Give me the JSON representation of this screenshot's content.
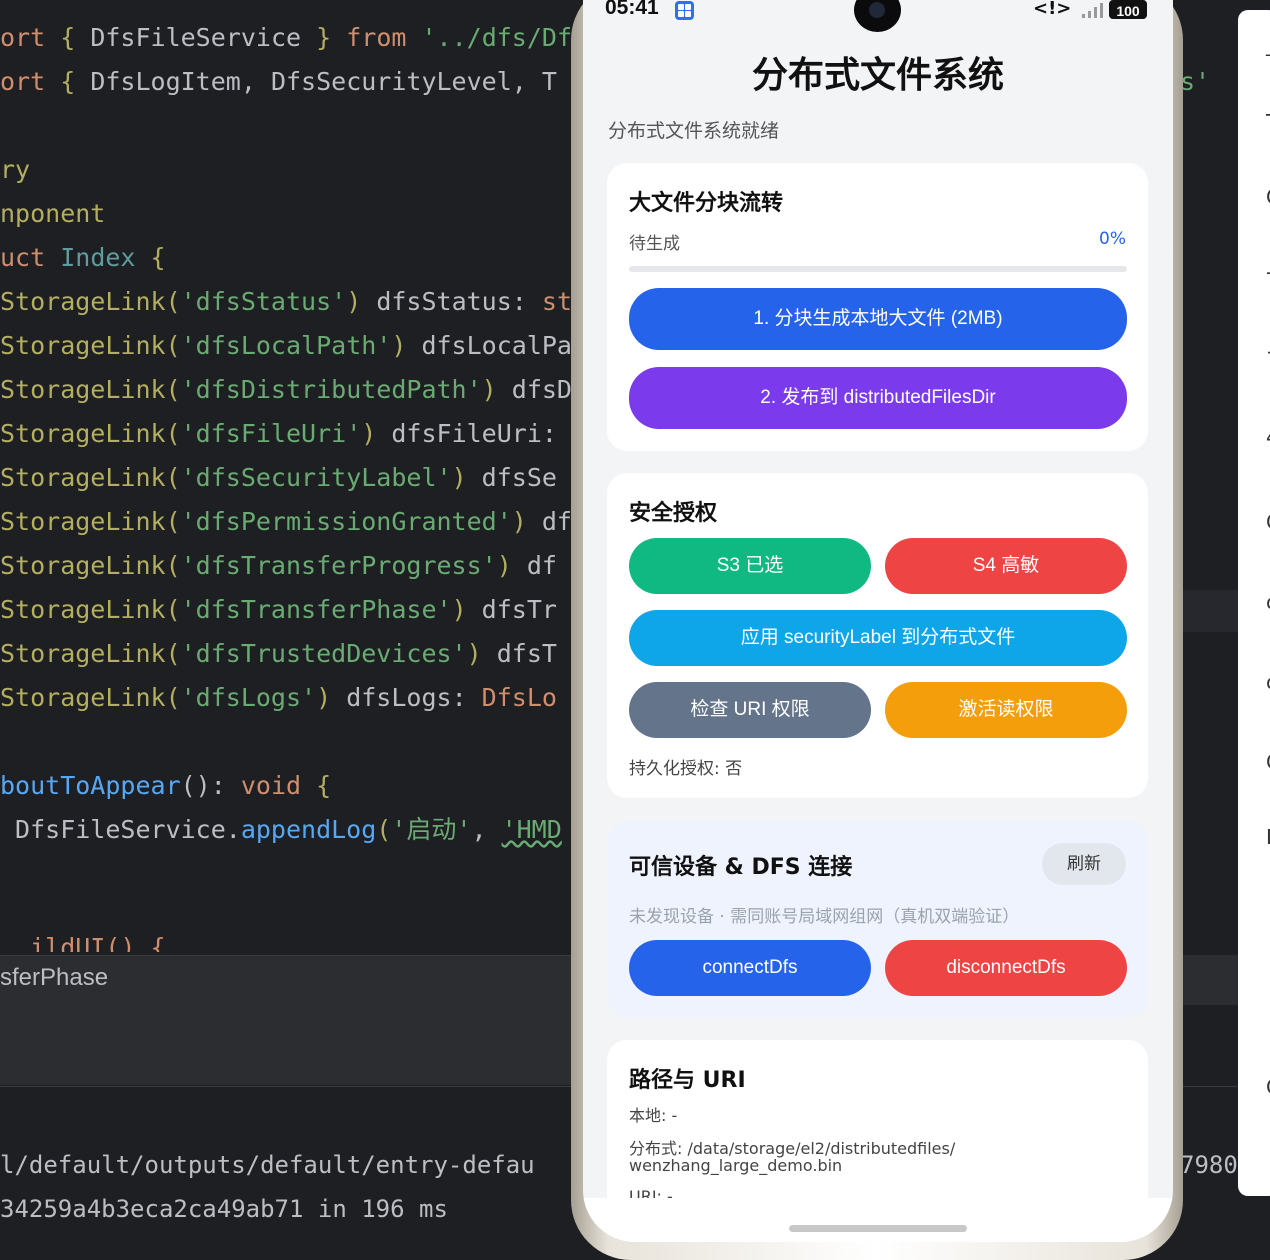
{
  "editor": {
    "lines": [
      {
        "p1": "ort ",
        "p2": "{ ",
        "p3": "DfsFileService ",
        "p4": "} ",
        "p5": "from ",
        "p6": "'../dfs/Df"
      },
      {
        "p1": "ort ",
        "p2": "{ ",
        "p3": "DfsLogItem, DfsSecurityLevel, T",
        "p4": "",
        "p5": "",
        "p6": ""
      },
      {
        "p1": "ry"
      },
      {
        "p1": "nponent"
      },
      {
        "p1": "uct ",
        "p2": "Index ",
        "p3": "{"
      }
    ],
    "storage_links": [
      {
        "key": "'dfsStatus'",
        "var": " dfsStatus: ",
        "tail": "st"
      },
      {
        "key": "'dfsLocalPath'",
        "var": " dfsLocalPa",
        "tail": ""
      },
      {
        "key": "'dfsDistributedPath'",
        "var": " dfsD",
        "tail": ""
      },
      {
        "key": "'dfsFileUri'",
        "var": " dfsFileUri:",
        "tail": ""
      },
      {
        "key": "'dfsSecurityLabel'",
        "var": " dfsSe",
        "tail": ""
      },
      {
        "key": "'dfsPermissionGranted'",
        "var": " df",
        "tail": ""
      },
      {
        "key": "'dfsTransferProgress'",
        "var": " df",
        "tail": ""
      },
      {
        "key": "'dfsTransferPhase'",
        "var": " dfsTr",
        "tail": ""
      },
      {
        "key": "'dfsTrustedDevices'",
        "var": " dfsT",
        "tail": ""
      },
      {
        "key": "'dfsLogs'",
        "var": " dfsLogs: ",
        "tail": "DfsLo"
      }
    ],
    "storage_prefix": "StorageLink(",
    "storage_close": ")",
    "about_fn": "boutToAppear",
    "about_rest": "(): ",
    "about_void": "void",
    "about_brace": " {",
    "append_obj": " DfsFileService.",
    "append_fn": "appendLog",
    "append_arg1": "'启动'",
    "append_comma": ", ",
    "append_arg2": "'HMD",
    "partial_line": "  ildUI() {",
    "right_fragment": "s'"
  },
  "breadcrumb": "sferPhase",
  "console": {
    "line1": "l/default/outputs/default/entry-defau",
    "line1_right": "7980",
    "line2": "34259a4b3eca2ca49ab71 in 196 ms"
  },
  "right_panel_glyphs": [
    "_",
    "T",
    "C",
    "-",
    "+",
    "4",
    "C",
    "c",
    "c",
    "C",
    "D",
    "C"
  ],
  "phone": {
    "status_bar": {
      "time": "05:41",
      "signal_text": "<!>",
      "battery": "100"
    },
    "title": "分布式文件系统",
    "status": "分布式文件系统就绪",
    "large_file_card": {
      "title": "大文件分块流转",
      "phase": "待生成",
      "percent_label": "0%",
      "progress": 0,
      "btn_generate": "1. 分块生成本地大文件 (2MB)",
      "btn_publish": "2. 发布到 distributedFilesDir"
    },
    "security_card": {
      "title": "安全授权",
      "btn_s3": "S3 已选",
      "btn_s4": "S4 高敏",
      "btn_apply_label": "应用 securityLabel 到分布式文件",
      "btn_check_uri": "检查 URI 权限",
      "btn_activate": "激活读权限",
      "persist": "持久化授权: 否"
    },
    "trusted_card": {
      "title": "可信设备 & DFS 连接",
      "refresh": "刷新",
      "hint": "未发现设备 · 需同账号局域网组网（真机双端验证）",
      "btn_connect": "connectDfs",
      "btn_disconnect": "disconnectDfs"
    },
    "path_card": {
      "title": "路径与 URI",
      "local": "本地: -",
      "distributed_1": "分布式: /data/storage/el2/distributedfiles/",
      "distributed_2": "wenzhang_large_demo.bin",
      "uri": "URI: -"
    },
    "colors": {
      "blue": "#2563eb",
      "purple": "#7c3aed",
      "green": "#10b981",
      "red": "#ef4444",
      "cyan": "#0ea5e9",
      "slate": "#64748b",
      "amber": "#f59e0b"
    }
  }
}
